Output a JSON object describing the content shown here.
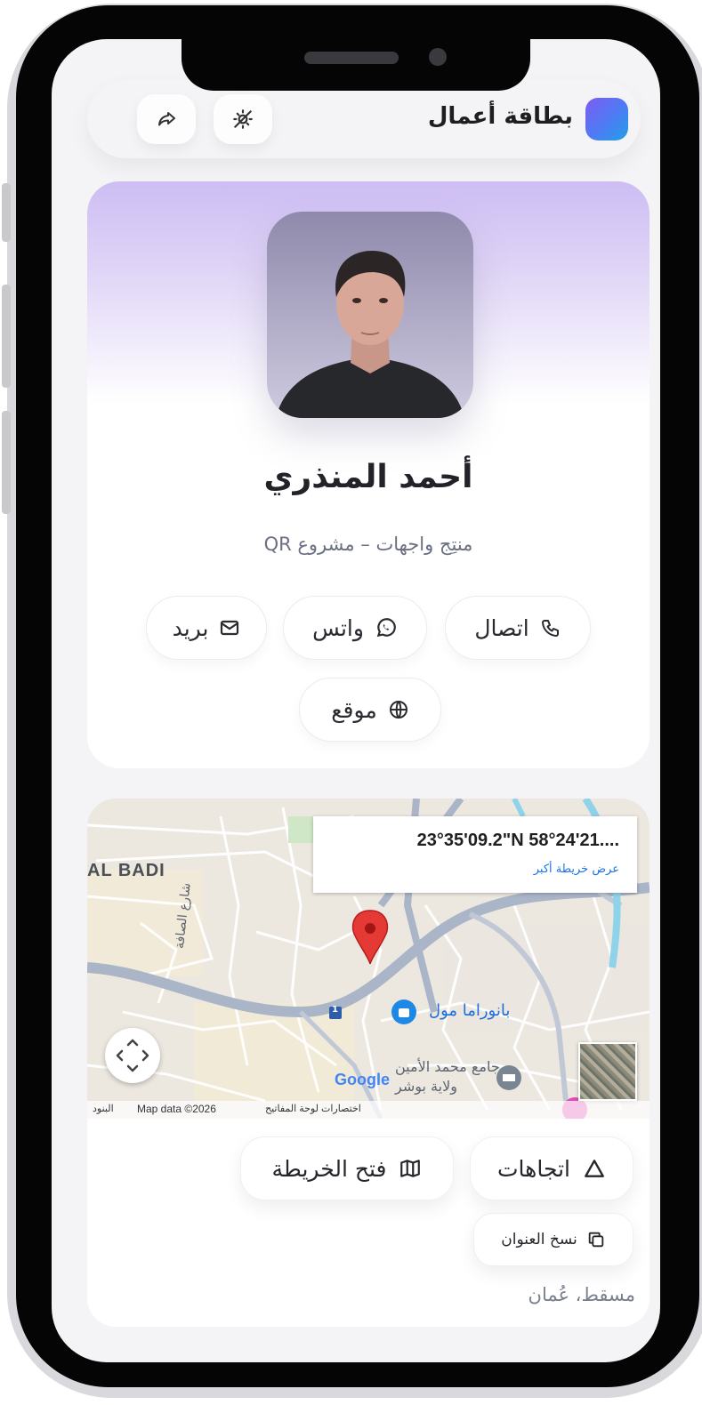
{
  "header": {
    "app_title": "بطاقة أعمال",
    "buttons": [
      "share",
      "theme-toggle"
    ]
  },
  "profile": {
    "name": "أحمد المنذري",
    "role": "منتِج واجهات – مشروع QR"
  },
  "contact_actions": [
    {
      "label": "اتصال",
      "icon": "phone-icon"
    },
    {
      "label": "واتس",
      "icon": "whatsapp-icon"
    },
    {
      "label": "بريد",
      "icon": "mail-icon"
    },
    {
      "label": "موقع",
      "icon": "globe-icon"
    }
  ],
  "map": {
    "coordinates": "23°35'09.2\"N 58°24'21....",
    "larger_map_link": "عرض خريطة أكبر",
    "labels": {
      "district": "AL BADI",
      "street": "شارع الصافة",
      "mall": "بانوراما مول",
      "mosque": "جامع محمد الأمين",
      "wilayah": "ولاية بوشر",
      "route": "1"
    },
    "footer": {
      "data": "Map data ©2026",
      "shortcuts": "اختصارات لوحة المفاتيح",
      "terms": "البنود"
    },
    "google": "Google"
  },
  "map_actions": {
    "directions": "اتجاهات",
    "open_map": "فتح الخريطة",
    "copy_address": "نسخ العنوان"
  },
  "address": "مسقط، عُمان",
  "colors": {
    "accent_purple": "#7b5cf0",
    "accent_blue": "#1fa0e6",
    "map_pin": "#e53935",
    "link": "#1a73e8"
  }
}
